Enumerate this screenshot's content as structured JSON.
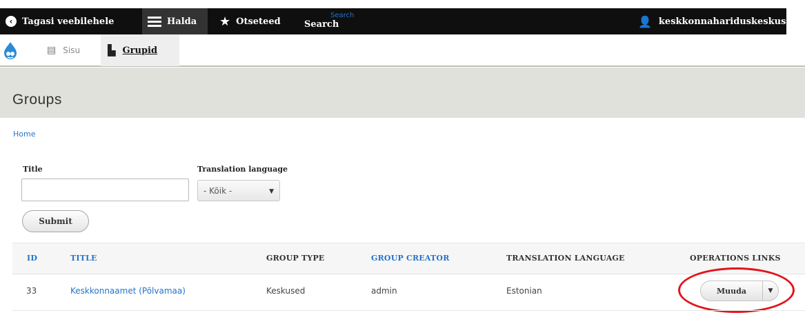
{
  "toolbar": {
    "back_label": "Tagasi veebilehele",
    "manage_label": "Halda",
    "shortcuts_label": "Otseteed",
    "search_hint": "Search",
    "search_label": "Search",
    "user_label": "keskkonnahariduskeskus"
  },
  "tray": {
    "content_label": "Sisu",
    "groups_label": "Grupid"
  },
  "page": {
    "title": "Groups",
    "breadcrumb": "Home"
  },
  "filters": {
    "title_label": "Title",
    "title_value": "",
    "language_label": "Translation language",
    "language_selected": "- Kõik -",
    "submit_label": "Submit"
  },
  "table": {
    "headers": [
      "ID",
      "TITLE",
      "GROUP TYPE",
      "GROUP CREATOR",
      "TRANSLATION LANGUAGE",
      "OPERATIONS LINKS"
    ],
    "rows": [
      {
        "id": "33",
        "title": "Keskkonnaamet (Põlvamaa)",
        "group_type": "Keskused",
        "creator": "admin",
        "language": "Estonian",
        "operation": "Muuda"
      }
    ]
  },
  "colors": {
    "link": "#2474c9",
    "toolbar": "#0f0f0f",
    "highlight": "#e2141c"
  }
}
